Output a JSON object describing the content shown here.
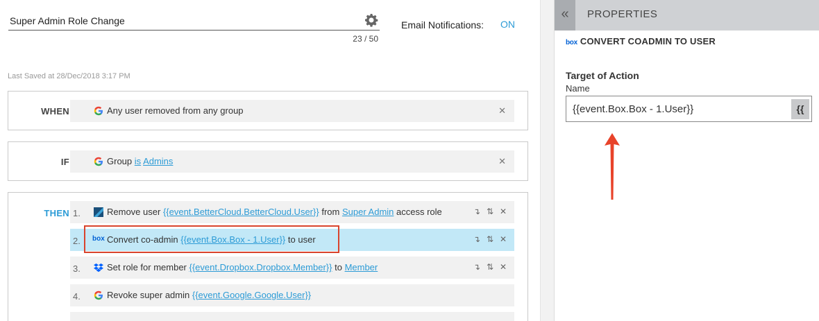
{
  "header": {
    "title": "Super Admin Role Change",
    "char_count": "23 / 50",
    "email_label": "Email Notifications:",
    "email_state": "ON",
    "last_saved": "Last Saved at 28/Dec/2018 3:17 PM"
  },
  "when": {
    "label": "WHEN",
    "icon": "google-icon",
    "text": "Any user removed from any group"
  },
  "if": {
    "label": "IF",
    "icon": "google-icon",
    "prefix": "Group",
    "operator": "is",
    "value": "Admins"
  },
  "then": {
    "label": "THEN",
    "actions": [
      {
        "num": "1.",
        "icon": "bettercloud-icon",
        "pre": "Remove user",
        "var": "{{event.BetterCloud.BetterCloud.User}}",
        "mid": "from",
        "link2": "Super Admin",
        "post": "access role"
      },
      {
        "num": "2.",
        "icon": "box-icon",
        "pre": "Convert co-admin",
        "var": "{{event.Box.Box - 1.User}}",
        "mid": "to user",
        "link2": "",
        "post": ""
      },
      {
        "num": "3.",
        "icon": "dropbox-icon",
        "pre": "Set role for member",
        "var": "{{event.Dropbox.Dropbox.Member}}",
        "mid": "to",
        "link2": "Member",
        "post": ""
      },
      {
        "num": "4.",
        "icon": "google-icon",
        "pre": "Revoke super admin",
        "var": "{{event.Google.Google.User}}",
        "mid": "",
        "link2": "",
        "post": ""
      }
    ]
  },
  "panel": {
    "title": "PROPERTIES",
    "collapse_glyph": "«",
    "box_logo": "box",
    "action_title": "CONVERT COADMIN TO USER",
    "target_label": "Target of Action",
    "name_label": "Name",
    "name_value": "{{event.Box.Box - 1.User}}",
    "var_button": "{{"
  },
  "colors": {
    "accent": "#2c9bd6",
    "selected_row": "#c2e8f7",
    "highlight": "#d9432c"
  }
}
